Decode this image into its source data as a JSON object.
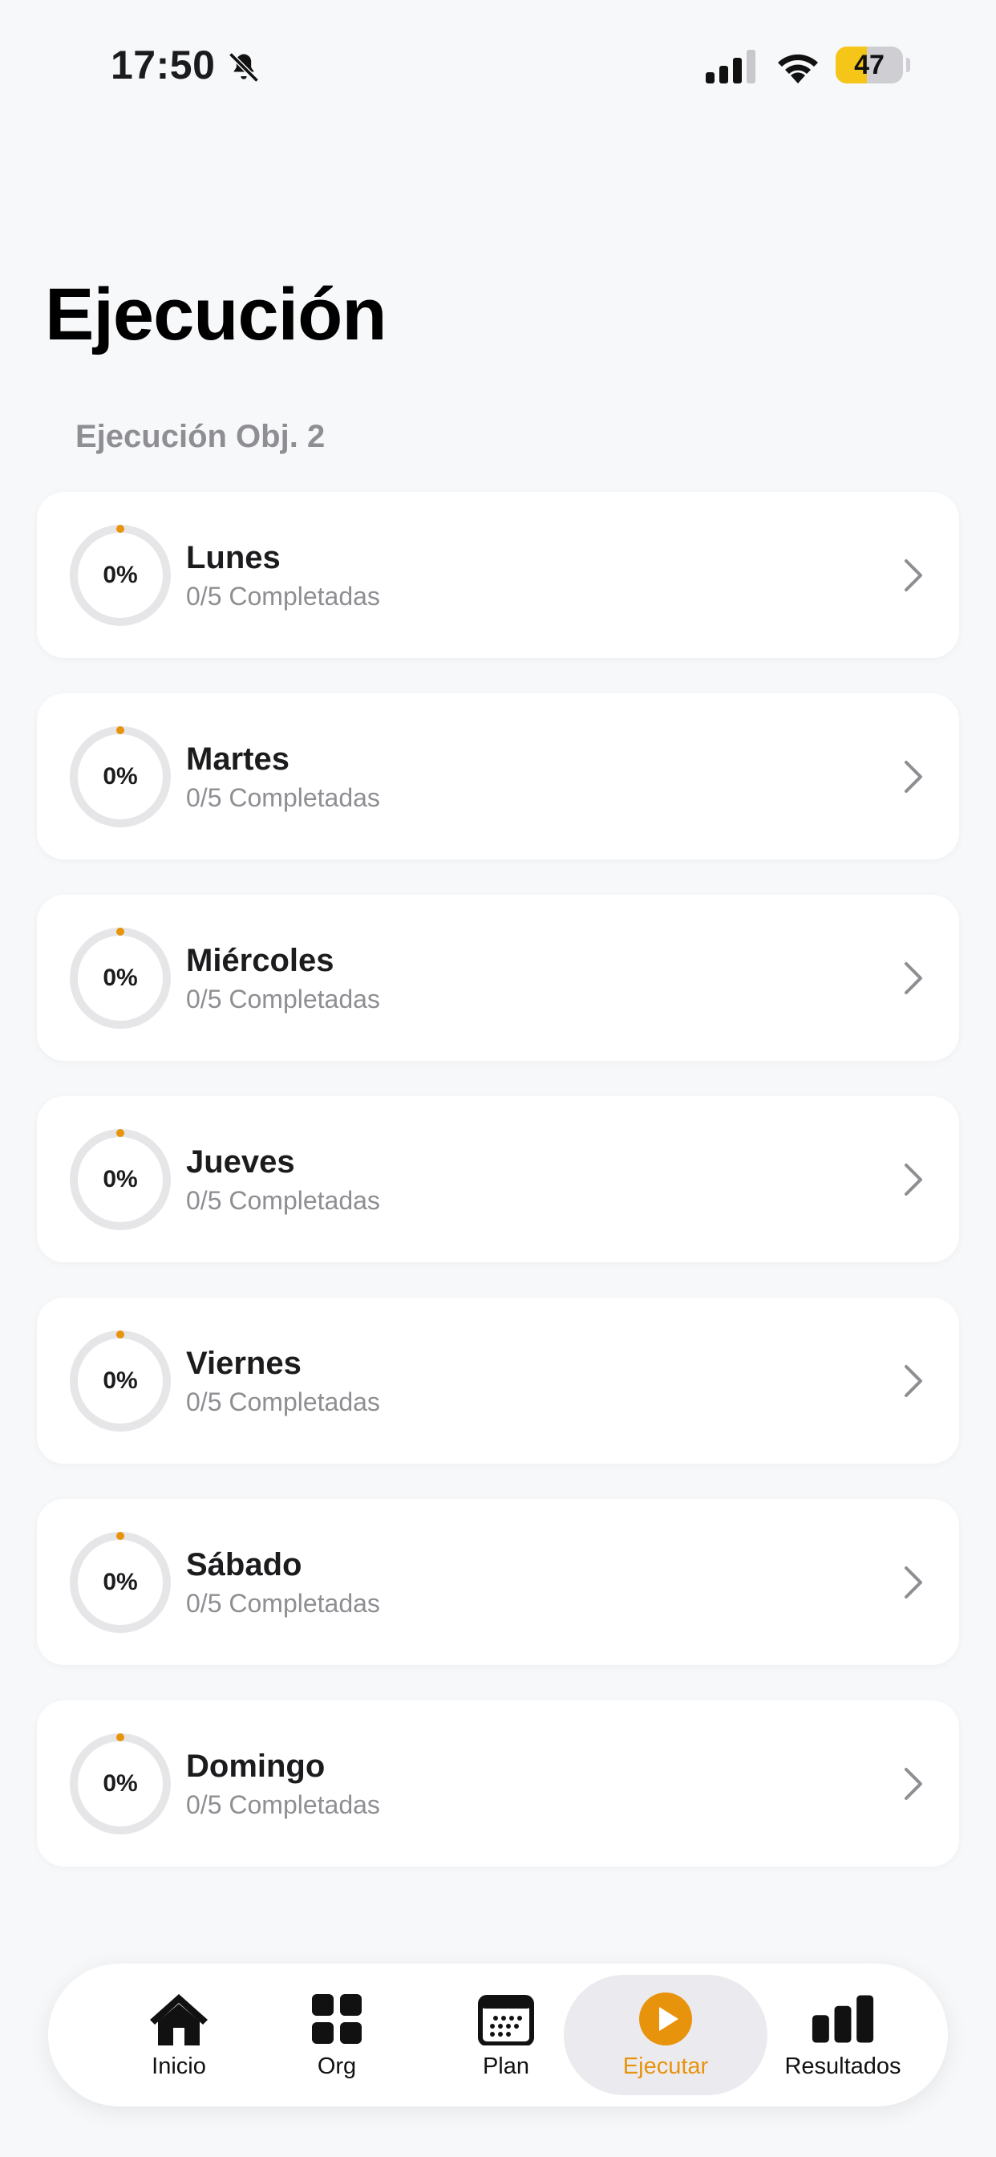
{
  "status_bar": {
    "time": "17:50",
    "battery": "47",
    "battery_level": 0.47,
    "icons": [
      "bell-slash-icon",
      "cellular-signal-icon",
      "wifi-icon",
      "battery-icon"
    ]
  },
  "header": {
    "title": "Ejecución",
    "section": "Ejecución Obj. 2"
  },
  "days": [
    {
      "name": "Lunes",
      "percent": "0%",
      "completed": "0/5 Completadas",
      "progress": 0
    },
    {
      "name": "Martes",
      "percent": "0%",
      "completed": "0/5 Completadas",
      "progress": 0
    },
    {
      "name": "Miércoles",
      "percent": "0%",
      "completed": "0/5 Completadas",
      "progress": 0
    },
    {
      "name": "Jueves",
      "percent": "0%",
      "completed": "0/5 Completadas",
      "progress": 0
    },
    {
      "name": "Viernes",
      "percent": "0%",
      "completed": "0/5 Completadas",
      "progress": 0
    },
    {
      "name": "Sábado",
      "percent": "0%",
      "completed": "0/5 Completadas",
      "progress": 0
    },
    {
      "name": "Domingo",
      "percent": "0%",
      "completed": "0/5 Completadas",
      "progress": 0
    }
  ],
  "tab_bar": {
    "tabs": [
      {
        "label": "Inicio",
        "icon": "home-icon",
        "active": false
      },
      {
        "label": "Org",
        "icon": "grid-icon",
        "active": false
      },
      {
        "label": "Plan",
        "icon": "calendar-icon",
        "active": false
      },
      {
        "label": "Ejecutar",
        "icon": "play-circle-icon",
        "active": true
      },
      {
        "label": "Resultados",
        "icon": "bar-chart-icon",
        "active": false
      }
    ]
  },
  "colors": {
    "accent": "#e8930c",
    "background": "#f7f8fa",
    "ring_track": "#e6e6e8",
    "battery_fill": "#f5c518"
  }
}
